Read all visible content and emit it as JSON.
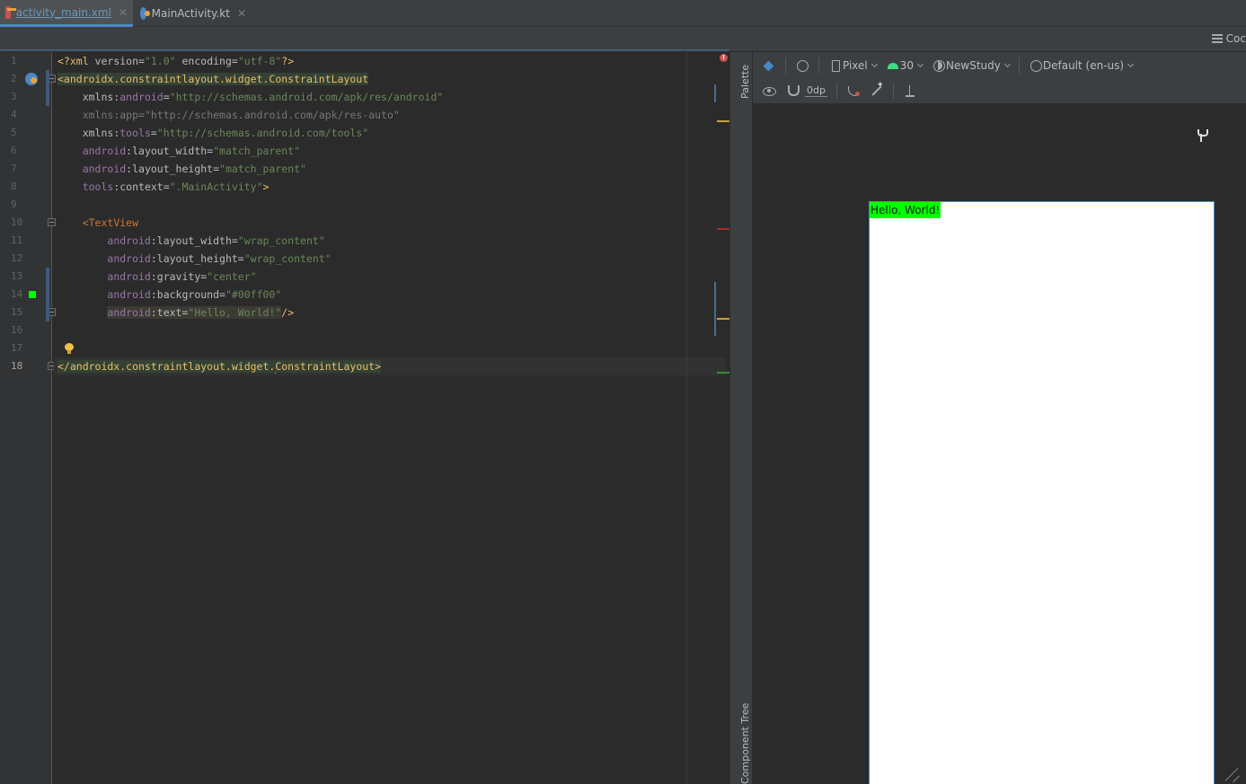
{
  "tabs": [
    {
      "label": "activity_main.xml",
      "active": true
    },
    {
      "label": "MainActivity.kt",
      "active": false
    }
  ],
  "code_view_label": "Coc",
  "line_numbers": [
    "1",
    "2",
    "3",
    "4",
    "5",
    "6",
    "7",
    "8",
    "9",
    "10",
    "11",
    "12",
    "13",
    "14",
    "15",
    "16",
    "17",
    "18"
  ],
  "code": {
    "l1": {
      "a": "<?xml ",
      "b": "version",
      "c": "=",
      "d": "\"1.0\"",
      "e": " encoding",
      "f": "=",
      "g": "\"utf-8\"",
      "h": "?>"
    },
    "l2": {
      "tag": "<androidx.constraintlayout.widget.ConstraintLayout"
    },
    "l3": {
      "a": "xmlns:",
      "b": "android",
      "c": "=",
      "d": "\"http://schemas.android.com/apk/res/android\""
    },
    "l4": {
      "a": "xmlns:",
      "b": "app",
      "c": "=",
      "d": "\"http://schemas.android.com/apk/res-auto\""
    },
    "l5": {
      "a": "xmlns:",
      "b": "tools",
      "c": "=",
      "d": "\"http://schemas.android.com/tools\""
    },
    "l6": {
      "ns": "android",
      "attr": ":layout_width",
      "eq": "=",
      "val": "\"match_parent\""
    },
    "l7": {
      "ns": "android",
      "attr": ":layout_height",
      "eq": "=",
      "val": "\"match_parent\""
    },
    "l8": {
      "ns": "tools",
      "attr": ":context",
      "eq": "=",
      "val": "\".MainActivity\"",
      "end": ">"
    },
    "l10": {
      "tag": "<TextView"
    },
    "l11": {
      "ns": "android",
      "attr": ":layout_width",
      "eq": "=",
      "val": "\"wrap_content\""
    },
    "l12": {
      "ns": "android",
      "attr": ":layout_height",
      "eq": "=",
      "val": "\"wrap_content\""
    },
    "l13": {
      "ns": "android",
      "attr": ":gravity",
      "eq": "=",
      "val": "\"center\""
    },
    "l14": {
      "ns": "android",
      "attr": ":background",
      "eq": "=",
      "val": "\"#00ff00\""
    },
    "l15": {
      "ns": "android",
      "attr": ":text",
      "eq": "=",
      "val": "\"Hello, World!\"",
      "end": "/>"
    },
    "l18": {
      "before": "</androidx.constraintlayout.widget.",
      "after": "ConstraintLayout>"
    }
  },
  "side_panels": {
    "palette": "Palette",
    "component_tree": "Component Tree"
  },
  "design_toolbar": {
    "device": "Pixel",
    "api": "30",
    "theme": "NewStudy",
    "locale": "Default (en-us)",
    "default_margin": "0dp"
  },
  "preview": {
    "text": "Hello, World!",
    "text_background": "#00ff00"
  },
  "colors": {
    "accent": "#4a88c7",
    "editor_bg": "#2b2b2b",
    "panel_bg": "#3c3f41"
  }
}
